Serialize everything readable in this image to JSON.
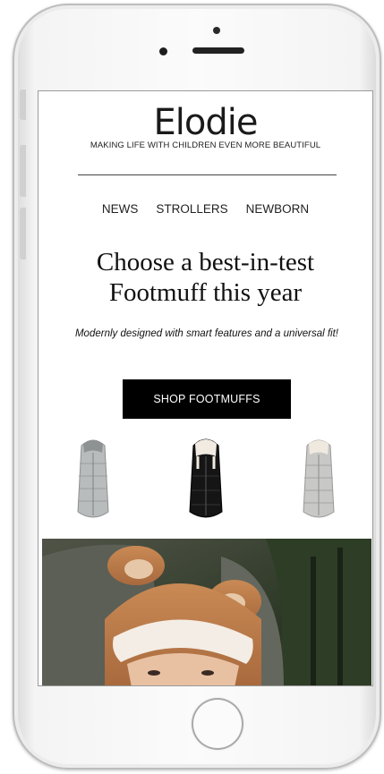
{
  "brand": {
    "logo": "Elodie",
    "tagline": "MAKING LIFE WITH CHILDREN EVEN MORE BEAUTIFUL"
  },
  "nav": {
    "items": [
      "NEWS",
      "STROLLERS",
      "NEWBORN"
    ]
  },
  "hero": {
    "headline_line1": "Choose a best-in-test",
    "headline_line2": "Footmuff this year",
    "subheading": "Modernly designed with smart features and a universal fit!",
    "cta_label": "SHOP FOOTMUFFS"
  },
  "products": [
    {
      "name": "grey footmuff",
      "color": "#b9bcbd"
    },
    {
      "name": "black footmuff",
      "color": "#151515"
    },
    {
      "name": "silver footmuff",
      "color": "#c8c8c6"
    }
  ],
  "colors": {
    "cta_background": "#000000",
    "text": "#111111"
  }
}
